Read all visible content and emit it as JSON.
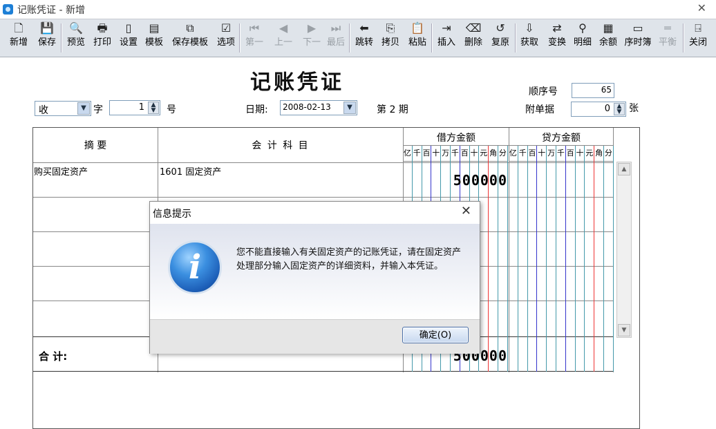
{
  "window": {
    "title": "记账凭证 - 新增",
    "close_glyph": "✕"
  },
  "toolbar": {
    "buttons": [
      {
        "label": "新增",
        "icon": "new-document-icon",
        "glyph": "🗋",
        "enabled": true
      },
      {
        "label": "保存",
        "icon": "save-icon",
        "glyph": "💾",
        "enabled": true
      },
      {
        "label": "预览",
        "icon": "preview-icon",
        "glyph": "🔍",
        "enabled": true
      },
      {
        "label": "打印",
        "icon": "print-icon",
        "glyph": "🖶",
        "enabled": true
      },
      {
        "label": "设置",
        "icon": "page-setup-icon",
        "glyph": "▯",
        "enabled": true
      },
      {
        "label": "模板",
        "icon": "template-icon",
        "glyph": "▤",
        "enabled": true
      },
      {
        "label": "保存模板",
        "icon": "save-template-icon",
        "glyph": "⧉",
        "enabled": true
      },
      {
        "label": "选项",
        "icon": "options-icon",
        "glyph": "☑",
        "enabled": true
      },
      {
        "label": "第一",
        "icon": "first-record-icon",
        "glyph": "⏮",
        "enabled": false
      },
      {
        "label": "上一",
        "icon": "previous-record-icon",
        "glyph": "◀",
        "enabled": false
      },
      {
        "label": "下一",
        "icon": "next-record-icon",
        "glyph": "▶",
        "enabled": false
      },
      {
        "label": "最后",
        "icon": "last-record-icon",
        "glyph": "⏭",
        "enabled": false
      },
      {
        "label": "跳转",
        "icon": "jump-arrow-icon",
        "glyph": "⬅",
        "enabled": true
      },
      {
        "label": "拷贝",
        "icon": "copy-icon",
        "glyph": "⎘",
        "enabled": true
      },
      {
        "label": "粘贴",
        "icon": "paste-icon",
        "glyph": "📋",
        "enabled": true
      },
      {
        "label": "插入",
        "icon": "insert-row-icon",
        "glyph": "⇥",
        "enabled": true
      },
      {
        "label": "删除",
        "icon": "delete-row-icon",
        "glyph": "⌫",
        "enabled": true
      },
      {
        "label": "复原",
        "icon": "restore-icon",
        "glyph": "↺",
        "enabled": true
      },
      {
        "label": "获取",
        "icon": "fetch-icon",
        "glyph": "⇩",
        "enabled": true
      },
      {
        "label": "变换",
        "icon": "transform-icon",
        "glyph": "⇄",
        "enabled": true
      },
      {
        "label": "明细",
        "icon": "binoculars-icon",
        "glyph": "⚲",
        "enabled": true
      },
      {
        "label": "余额",
        "icon": "balance-grid-icon",
        "glyph": "▦",
        "enabled": true
      },
      {
        "label": "序时簿",
        "icon": "journal-icon",
        "glyph": "▭",
        "enabled": true
      },
      {
        "label": "平衡",
        "icon": "balance-icon",
        "glyph": "═",
        "enabled": false
      },
      {
        "label": "关闭",
        "icon": "exit-door-icon",
        "glyph": "⍈",
        "enabled": true
      }
    ]
  },
  "voucher": {
    "title": "记账凭证",
    "word_type": "收",
    "word_label": "字",
    "number": "1",
    "number_label": "号",
    "date_label": "日期:",
    "date": "2008-02-13",
    "period_label": "第 2 期",
    "seq_label": "顺序号",
    "seq": "65",
    "attach_label": "附单据",
    "attach": "0",
    "attach_unit": "张"
  },
  "table": {
    "headers": {
      "summary": "摘    要",
      "account": "会 计 科 目",
      "debit": "借方金额",
      "credit": "贷方金额"
    },
    "digit_labels": [
      "亿",
      "千",
      "百",
      "十",
      "万",
      "千",
      "百",
      "十",
      "元",
      "角",
      "分"
    ],
    "rows": [
      {
        "summary": "购买固定资产",
        "account": "1601  固定资产",
        "debit": "500000",
        "credit": ""
      },
      {
        "summary": "",
        "account": "",
        "debit": "",
        "credit": ""
      },
      {
        "summary": "",
        "account": "",
        "debit": "",
        "credit": ""
      },
      {
        "summary": "",
        "account": "",
        "debit": "",
        "credit": ""
      },
      {
        "summary": "",
        "account": "",
        "debit": "",
        "credit": ""
      }
    ],
    "total_label": "合   计:",
    "total_debit": "500000",
    "total_credit": ""
  },
  "dialog": {
    "title": "信息提示",
    "message_line1": "您不能直接输入有关固定资产的记账凭证，请在固定资产",
    "message_line2": "处理部分输入固定资产的详细资料，并输入本凭证。",
    "ok_label": "确定(O)",
    "close_glyph": "✕",
    "icon_letter": "i"
  },
  "colors": {
    "digit_blue": "#4499aa",
    "digit_red": "#e33333",
    "toolbar_bg": "#dfe4ea",
    "dialog_body_top": "#dfe3ee"
  }
}
